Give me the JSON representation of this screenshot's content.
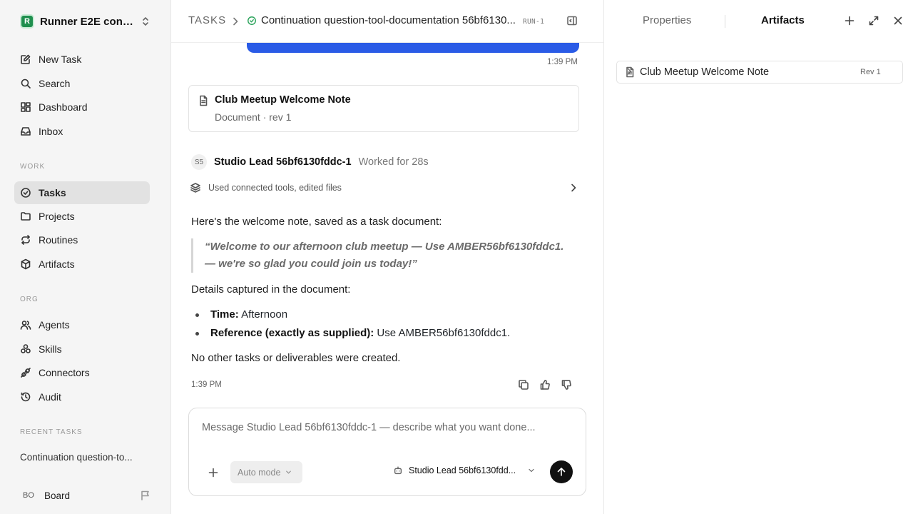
{
  "sidebar": {
    "workspace": {
      "logo": "R",
      "name": "Runner E2E conti..."
    },
    "nav_main": [
      {
        "label": "New Task",
        "icon": "edit-icon"
      },
      {
        "label": "Search",
        "icon": "search-icon"
      },
      {
        "label": "Dashboard",
        "icon": "dashboard-icon"
      },
      {
        "label": "Inbox",
        "icon": "inbox-icon"
      }
    ],
    "work_heading": "WORK",
    "nav_work": [
      {
        "label": "Tasks",
        "icon": "check-circle-icon",
        "active": true
      },
      {
        "label": "Projects",
        "icon": "folder-icon"
      },
      {
        "label": "Routines",
        "icon": "repeat-icon"
      },
      {
        "label": "Artifacts",
        "icon": "cube-icon"
      }
    ],
    "org_heading": "ORG",
    "nav_org": [
      {
        "label": "Agents",
        "icon": "users-icon"
      },
      {
        "label": "Skills",
        "icon": "skills-icon"
      },
      {
        "label": "Connectors",
        "icon": "plug-icon"
      },
      {
        "label": "Audit",
        "icon": "history-icon"
      }
    ],
    "recent_heading": "RECENT TASKS",
    "recent_items": [
      "Continuation question-to..."
    ],
    "user": {
      "initials": "BO",
      "name": "Board"
    }
  },
  "topbar": {
    "root": "TASKS",
    "title": "Continuation question-tool-documentation 56bf6130...",
    "run_badge": "RUN-1"
  },
  "thread": {
    "prev_time": "1:39 PM",
    "doc_card": {
      "title": "Club Meetup Welcome Note",
      "subtitle": "Document · rev 1"
    },
    "agent": {
      "initials": "S5",
      "name": "Studio Lead 56bf6130fddc-1",
      "worked": "Worked for 28s"
    },
    "tools_summary": "Used connected tools, edited files",
    "intro": "Here's the welcome note, saved as a task document:",
    "quote": "“Welcome to our afternoon club meetup — Use AMBER56bf6130fddc1. — we're so glad you could join us today!”",
    "details_heading": "Details captured in the document:",
    "details": [
      {
        "label": "Time:",
        "value": " Afternoon"
      },
      {
        "label": "Reference (exactly as supplied):",
        "value": " Use AMBER56bf6130fddc1."
      }
    ],
    "closing": "No other tasks or deliverables were created.",
    "time": "1:39 PM"
  },
  "composer": {
    "placeholder": "Message Studio Lead 56bf6130fddc-1 — describe what you want done...",
    "mode": "Auto mode",
    "agent": "Studio Lead 56bf6130fdd..."
  },
  "right_panel": {
    "tabs": [
      "Properties",
      "Artifacts"
    ],
    "active_tab": "Artifacts",
    "artifacts": [
      {
        "name": "Club Meetup Welcome Note",
        "rev": "Rev 1"
      }
    ]
  },
  "colors": {
    "accent_blue": "#2a5be6",
    "success_green": "#2ba35b",
    "logo_green": "#1f8f4e"
  }
}
